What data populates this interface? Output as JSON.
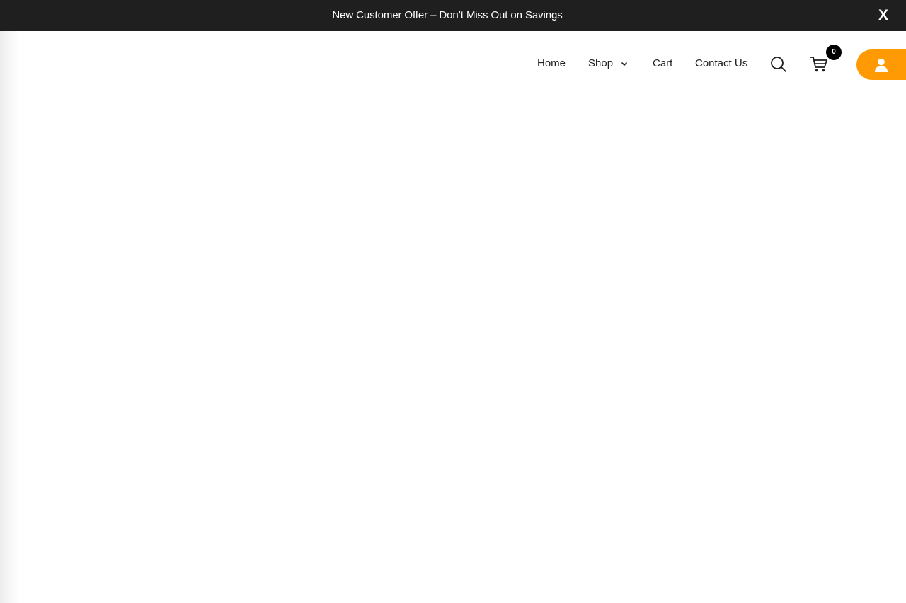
{
  "announcement": {
    "text": "New Customer Offer – Don’t Miss Out on Savings",
    "close_label": "X"
  },
  "nav": {
    "items": [
      {
        "label": "Home"
      },
      {
        "label": "Shop",
        "has_dropdown": true
      },
      {
        "label": "Cart"
      },
      {
        "label": "Contact Us"
      }
    ]
  },
  "header_icons": {
    "search_icon": "search-icon",
    "cart_icon": "cart-icon",
    "account_icon": "user-icon"
  },
  "cart": {
    "count": "0"
  },
  "colors": {
    "announcement_bg": "#1f1f1f",
    "accent": "#ff9a05",
    "text": "#1e1e1e",
    "badge_bg": "#000000"
  }
}
